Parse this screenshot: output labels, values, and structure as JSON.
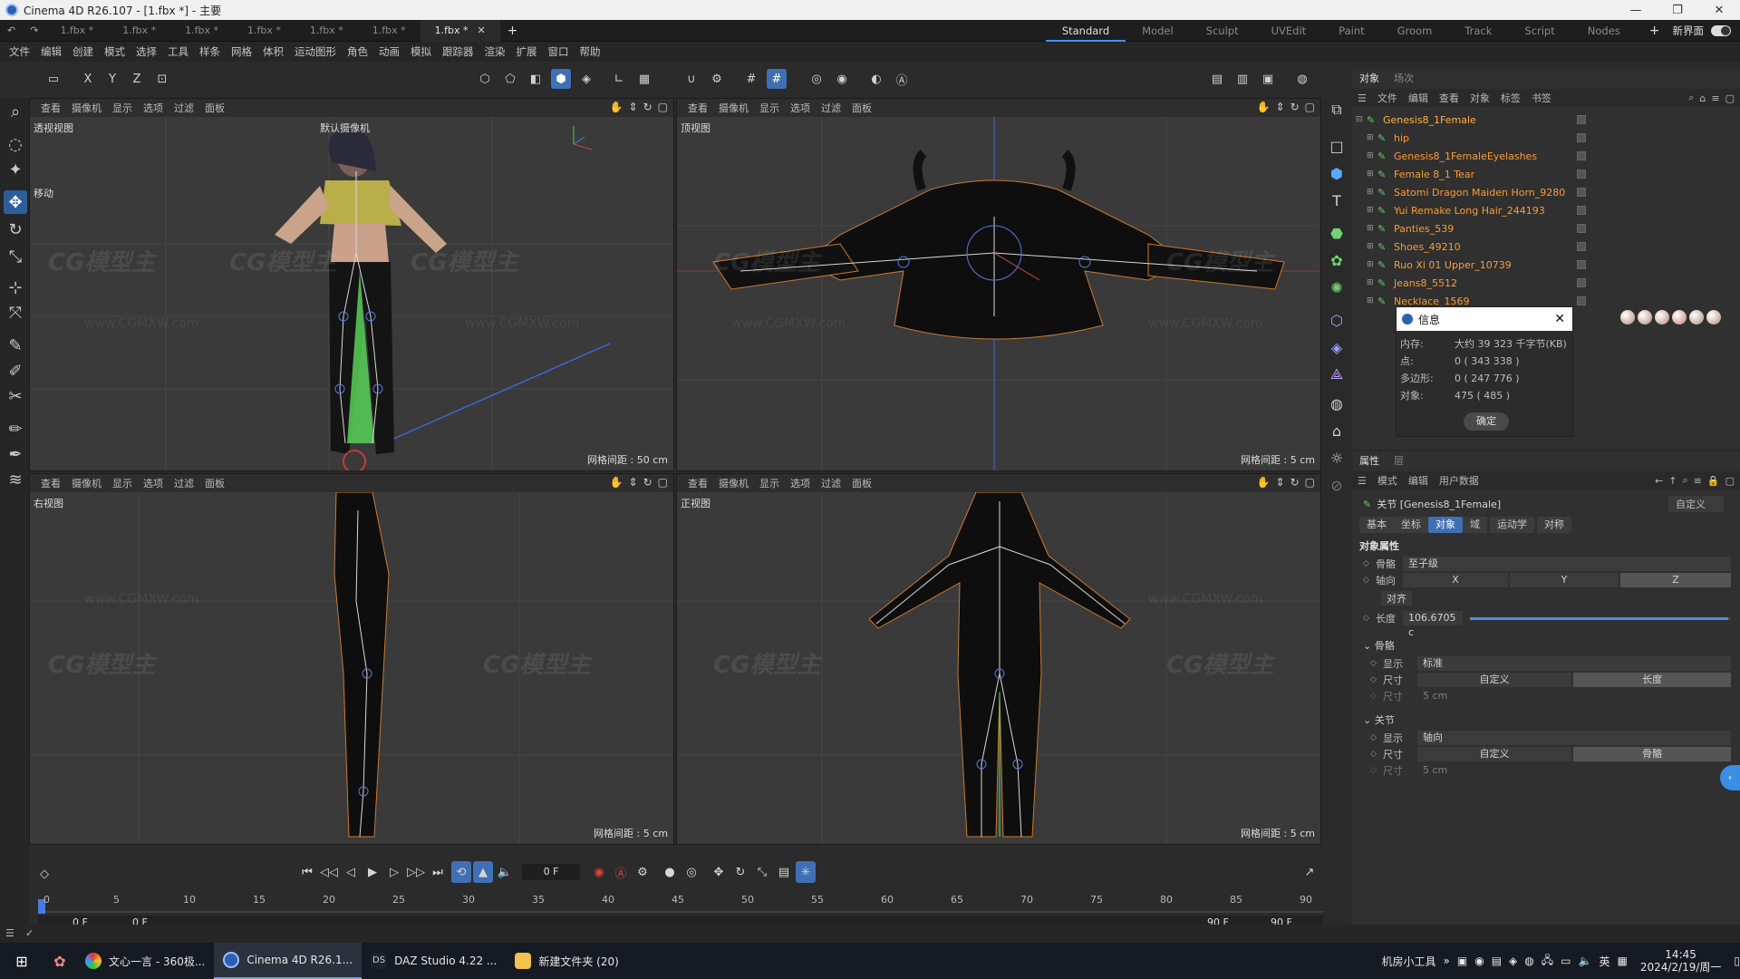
{
  "title_bar": {
    "title": "Cinema 4D R26.107 - [1.fbx *] - 主要"
  },
  "doc_tabs": [
    {
      "label": "1.fbx *"
    },
    {
      "label": "1.fbx *"
    },
    {
      "label": "1.fbx *"
    },
    {
      "label": "1.fbx *"
    },
    {
      "label": "1.fbx *"
    },
    {
      "label": "1.fbx *"
    },
    {
      "label": "1.fbx *"
    }
  ],
  "layout_tabs": [
    "Standard",
    "Model",
    "Sculpt",
    "UVEdit",
    "Paint",
    "Groom",
    "Track",
    "Script",
    "Nodes"
  ],
  "new_interface": "新界面",
  "menu": [
    "文件",
    "编辑",
    "创建",
    "模式",
    "选择",
    "工具",
    "样条",
    "网格",
    "体积",
    "运动图形",
    "角色",
    "动画",
    "模拟",
    "跟踪器",
    "渲染",
    "扩展",
    "窗口",
    "帮助"
  ],
  "axis_buttons": {
    "x": "X",
    "y": "Y",
    "z": "Z"
  },
  "viewport_menu": [
    "查看",
    "摄像机",
    "显示",
    "选项",
    "过滤",
    "面板"
  ],
  "viewports": {
    "perspective": {
      "label": "透视视图",
      "camera": "默认摄像机",
      "grid": "网格间距 : 50 cm",
      "move_hint": "移动"
    },
    "top": {
      "label": "顶视图",
      "grid": "网格间距 : 5 cm"
    },
    "right": {
      "label": "右视图",
      "grid": "网格间距 : 5 cm"
    },
    "front": {
      "label": "正视图",
      "grid": "网格间距 : 5 cm"
    }
  },
  "watermark": {
    "text": "CG模型主",
    "url": "www.CGMXW.com"
  },
  "timeline": {
    "frame_field": "0 F",
    "ticks": [
      "0",
      "5",
      "10",
      "15",
      "20",
      "25",
      "30",
      "35",
      "40",
      "45",
      "50",
      "55",
      "60",
      "65",
      "70",
      "75",
      "80",
      "85",
      "90"
    ],
    "start_a": "0 F",
    "start_b": "0 F",
    "end_a": "90 F",
    "end_b": "90 F"
  },
  "object_manager": {
    "tabs": [
      "对象",
      "场次"
    ],
    "menu": [
      "文件",
      "编辑",
      "查看",
      "对象",
      "标签",
      "书签"
    ],
    "root": "Genesis8_1Female",
    "children": [
      "hip",
      "Genesis8_1FemaleEyelashes",
      "Female 8_1 Tear",
      "Satomi Dragon Maiden Horn_9280",
      "Yui Remake Long Hair_244193",
      "Panties_539",
      "Shoes_49210",
      "Ruo Xi 01 Upper_10739",
      "Jeans8_5512",
      "Necklace_1569"
    ]
  },
  "info_dialog": {
    "title": "信息",
    "rows": [
      {
        "k": "内存:",
        "v": "大约 39 323 千字节(KB)"
      },
      {
        "k": "点:",
        "v": "0 ( 343 338 )"
      },
      {
        "k": "多边形:",
        "v": "0 ( 247 776 )"
      },
      {
        "k": "对象:",
        "v": "475 ( 485 )"
      }
    ],
    "ok": "确定"
  },
  "attribute_manager": {
    "tabs": [
      "属性",
      "层"
    ],
    "menu": [
      "模式",
      "编辑",
      "用户数据"
    ],
    "header": "关节 [Genesis8_1Female]",
    "preset": "自定义",
    "subtabs": [
      "基本",
      "坐标",
      "对象",
      "域",
      "运动学",
      "对称"
    ],
    "active_subtab": "对象",
    "section": "对象属性",
    "bone_label": "骨骼",
    "bone_value": "至子级",
    "axis_label": "轴向",
    "axis_x": "X",
    "axis_y": "Y",
    "axis_z": "Z",
    "align": "对齐",
    "length_label": "长度",
    "length_value": "106.6705 c",
    "length_fraction": 0.99,
    "bones_group": "骨骼",
    "display_label": "显示",
    "display_value": "标准",
    "size_label": "尺寸",
    "size_custom": "自定义",
    "size_length": "长度",
    "size2_label": "尺寸",
    "size2_value": "5 cm",
    "joints_group": "关节",
    "j_display_value": "轴向",
    "j_size_custom": "自定义",
    "j_size_bone": "骨骼",
    "j_size2_value": "5 cm"
  },
  "taskbar": {
    "apps": [
      {
        "label": "文心一言 - 360极..."
      },
      {
        "label": "Cinema 4D R26.1..."
      },
      {
        "label": "DAZ Studio 4.22 ..."
      },
      {
        "label": "新建文件夹 (20)"
      }
    ],
    "tray_label": "机房小工具",
    "ime": "英",
    "time": "14:45",
    "date": "2024/2/19/周一"
  }
}
